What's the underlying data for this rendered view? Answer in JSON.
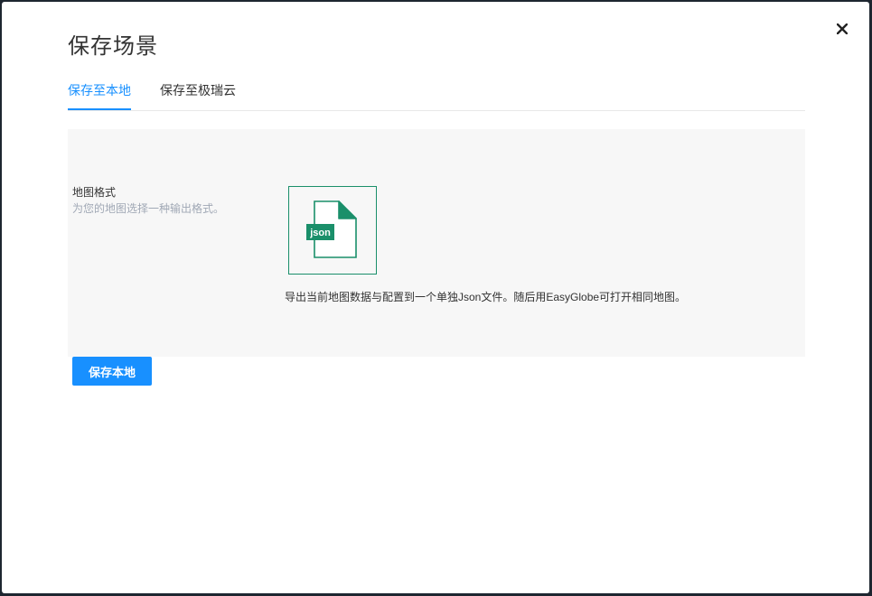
{
  "dialog": {
    "title": "保存场景",
    "close_icon": "close-icon"
  },
  "tabs": [
    {
      "label": "保存至本地",
      "active": true
    },
    {
      "label": "保存至极瑞云",
      "active": false
    }
  ],
  "format_section": {
    "label": "地图格式",
    "description": "为您的地图选择一种输出格式。",
    "json_option": {
      "badge": "json",
      "icon": "json-file-icon",
      "description": "导出当前地图数据与配置到一个单独Json文件。随后用EasyGlobe可打开相同地图。"
    }
  },
  "actions": {
    "save_label": "保存本地"
  },
  "colors": {
    "accent": "#1890ff",
    "json_green": "#1a8f6a"
  }
}
